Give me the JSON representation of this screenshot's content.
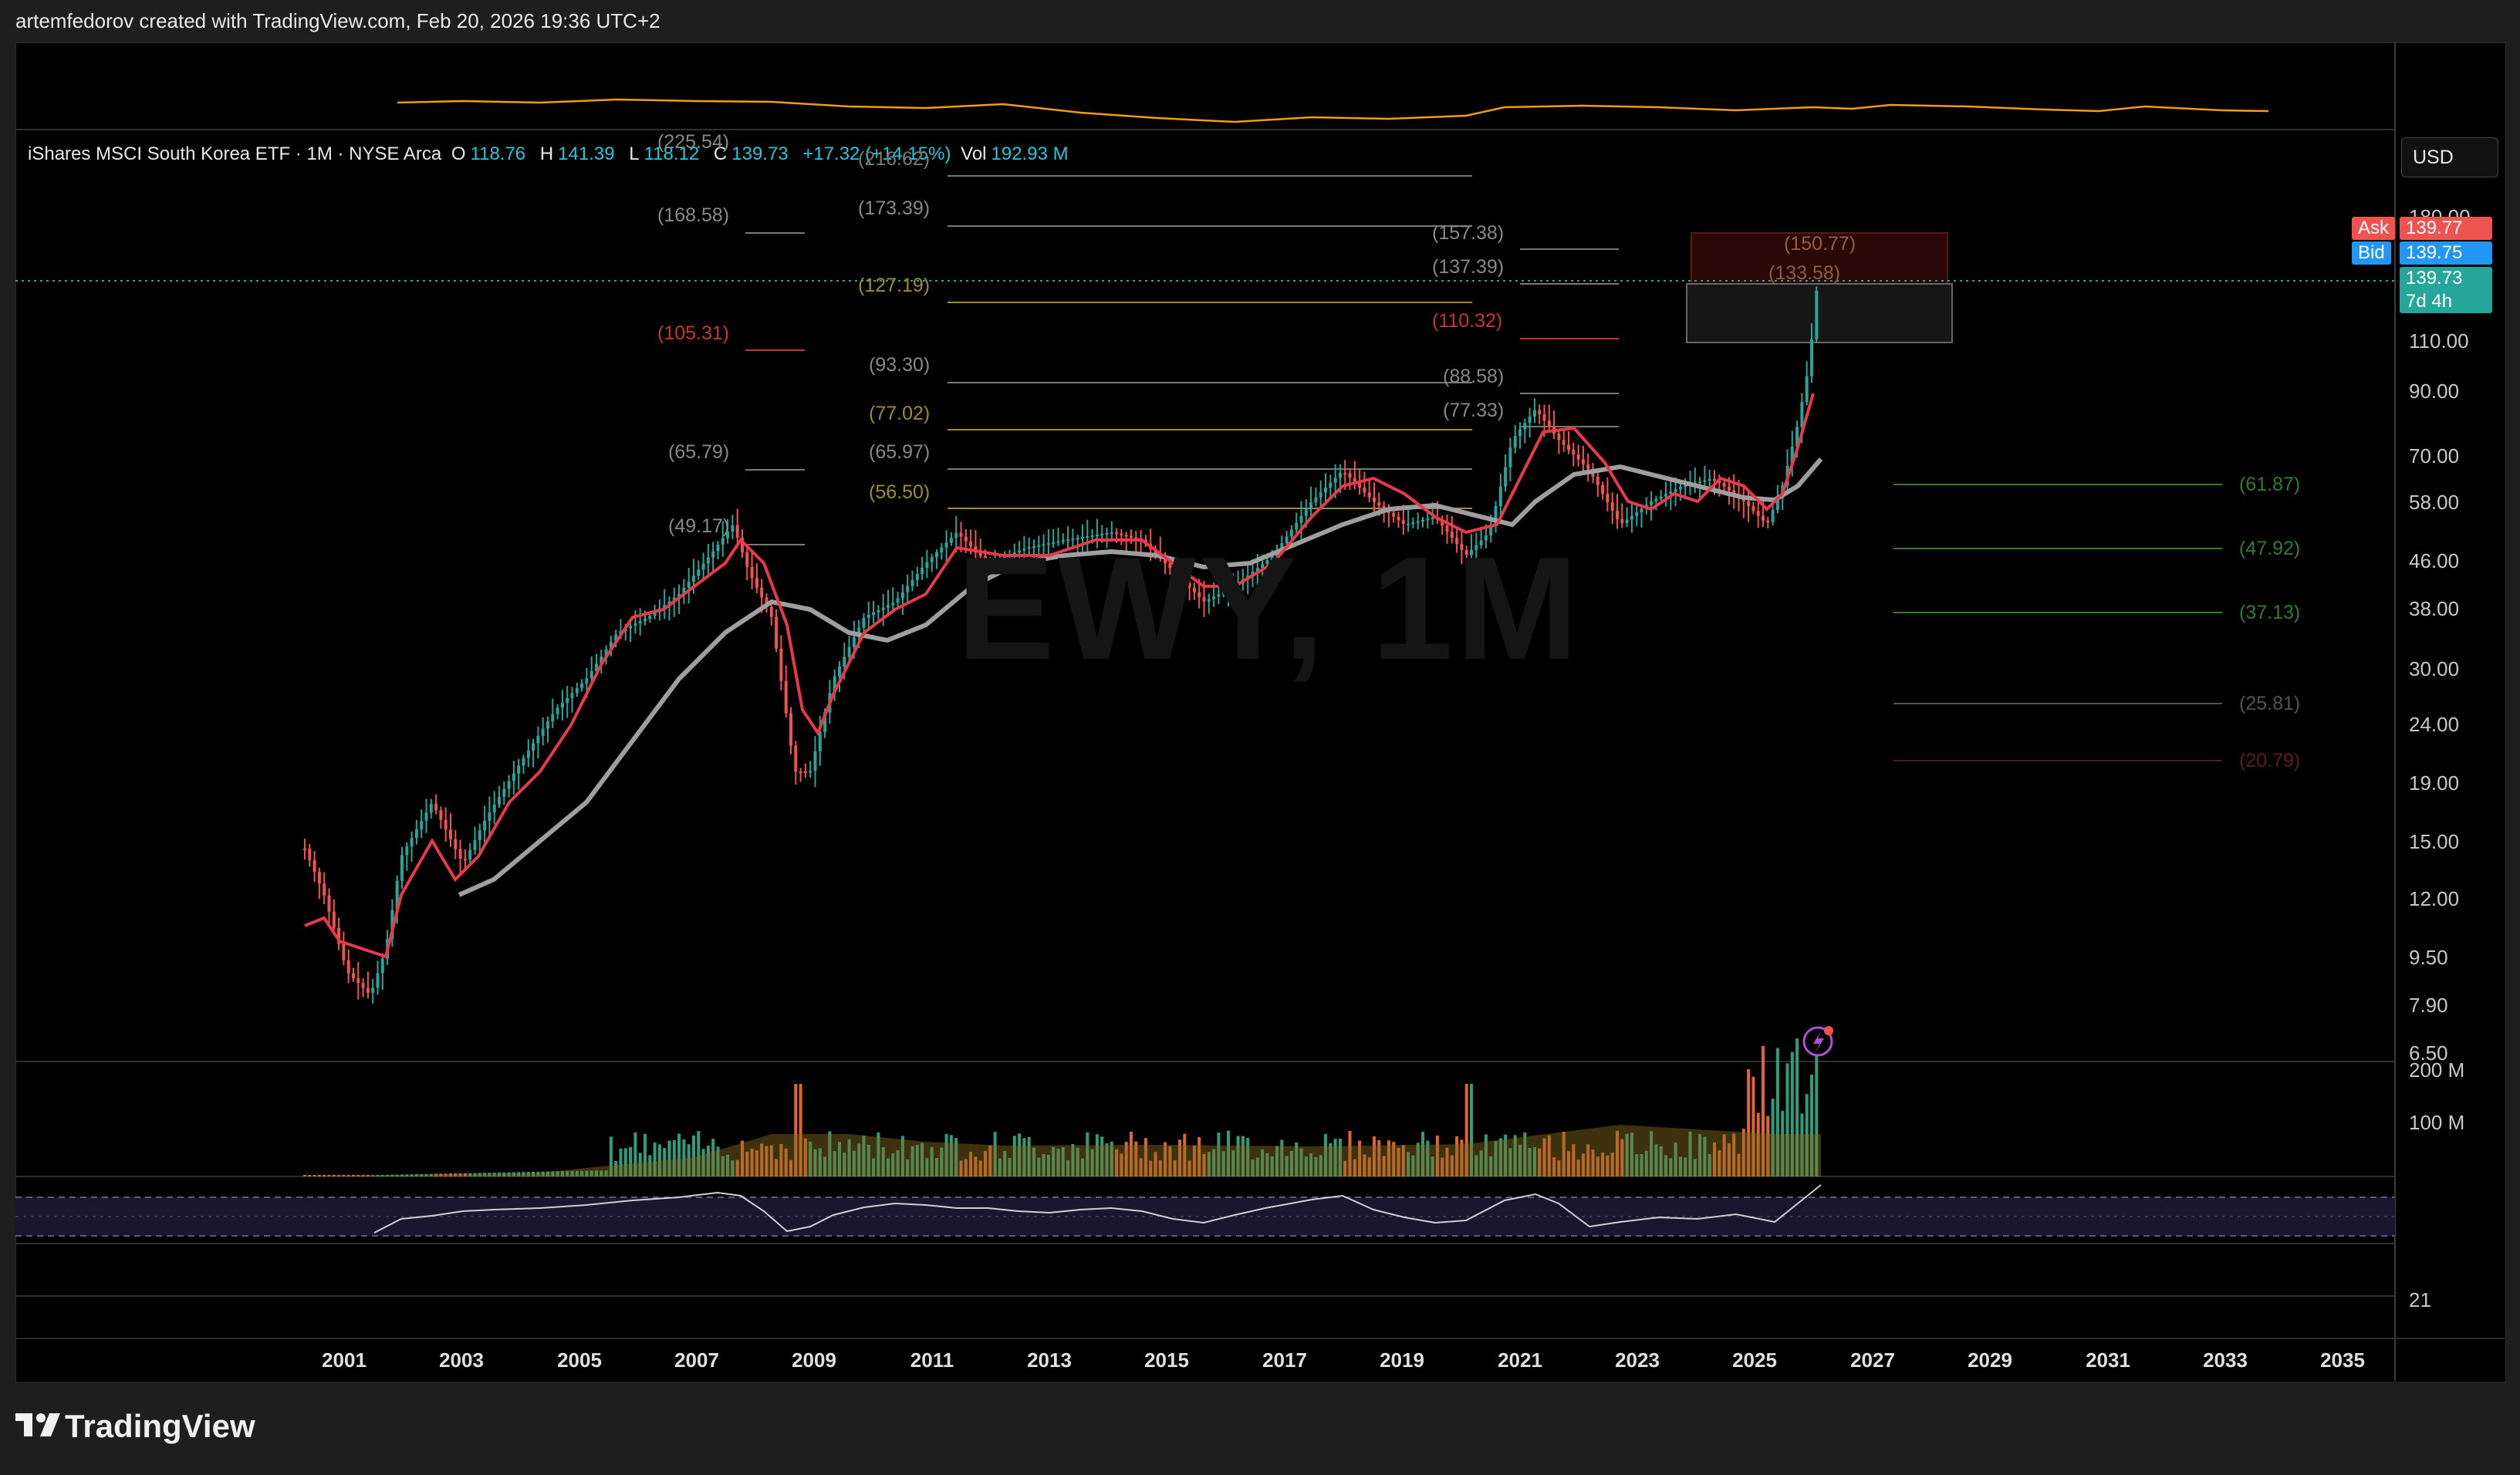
{
  "header": {
    "credit": "artemfedorov created with TradingView.com, Feb 20, 2026 19:36 UTC+2"
  },
  "legend": {
    "name": "iShares MSCI South Korea ETF · 1M · NYSE Arca",
    "o_label": "O",
    "o": "118.76",
    "h_label": "H",
    "h": "141.39",
    "l_label": "L",
    "l": "118.12",
    "c_label": "C",
    "c": "139.73",
    "change": "+17.32 (+14.15%)",
    "vol_label": "Vol",
    "vol": "192.93 M"
  },
  "watermark": "EWY, 1M",
  "currency_button": "USD",
  "price_tags": {
    "ask_label": "Ask",
    "ask": "139.77",
    "bid_label": "Bid",
    "bid": "139.75",
    "last": "139.73",
    "countdown": "7d 4h"
  },
  "y_axis": [
    "180.00",
    "110.00",
    "90.00",
    "70.00",
    "58.00",
    "46.00",
    "38.00",
    "30.00",
    "24.00",
    "19.00",
    "15.00",
    "12.00",
    "9.50",
    "7.90",
    "6.50"
  ],
  "volume_axis": [
    "200 M",
    "100 M"
  ],
  "rsi_axis": [
    "21"
  ],
  "x_axis": [
    "2001",
    "2003",
    "2005",
    "2007",
    "2009",
    "2011",
    "2013",
    "2015",
    "2017",
    "2019",
    "2021",
    "2023",
    "2025",
    "2027",
    "2029",
    "2031",
    "2033",
    "2035"
  ],
  "fib_levels": {
    "left": [
      "(225.54)",
      "(168.58)",
      "(105.31)",
      "(65.79)",
      "(49.17)"
    ],
    "middle": [
      "(216.62)",
      "(173.39)",
      "(127.19)",
      "(93.30)",
      "(77.02)",
      "(65.97)",
      "(56.50)"
    ],
    "right": [
      "(157.38)",
      "(137.39)",
      "(110.32)",
      "(88.58)",
      "(77.33)"
    ],
    "box": [
      "(150.77)",
      "(133.58)"
    ],
    "projection": [
      "(61.87)",
      "(47.92)",
      "(37.13)",
      "(25.81)",
      "(20.79)"
    ]
  },
  "colors": {
    "background": "#000000",
    "up": "#26a69a",
    "down": "#ef5350",
    "ma_fast": "#e8394a",
    "ma_slow": "#9e9e9e",
    "ask": "#ef5350",
    "bid": "#2196f3",
    "last": "#26a69a"
  },
  "logo": "TradingView"
}
